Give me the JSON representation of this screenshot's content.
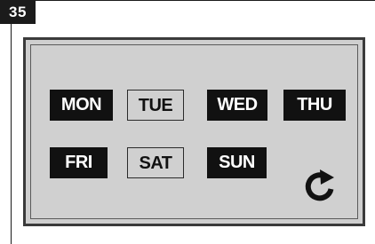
{
  "step": "35",
  "days": [
    {
      "label": "MON",
      "active": true
    },
    {
      "label": "TUE",
      "active": false
    },
    {
      "label": "WED",
      "active": true
    },
    {
      "label": "THU",
      "active": true
    },
    {
      "label": "FRI",
      "active": true
    },
    {
      "label": "SAT",
      "active": false
    },
    {
      "label": "SUN",
      "active": true
    }
  ],
  "icons": {
    "refresh": "refresh-icon"
  },
  "colors": {
    "active_bg": "#111111",
    "display_bg": "#d0d0d0"
  }
}
